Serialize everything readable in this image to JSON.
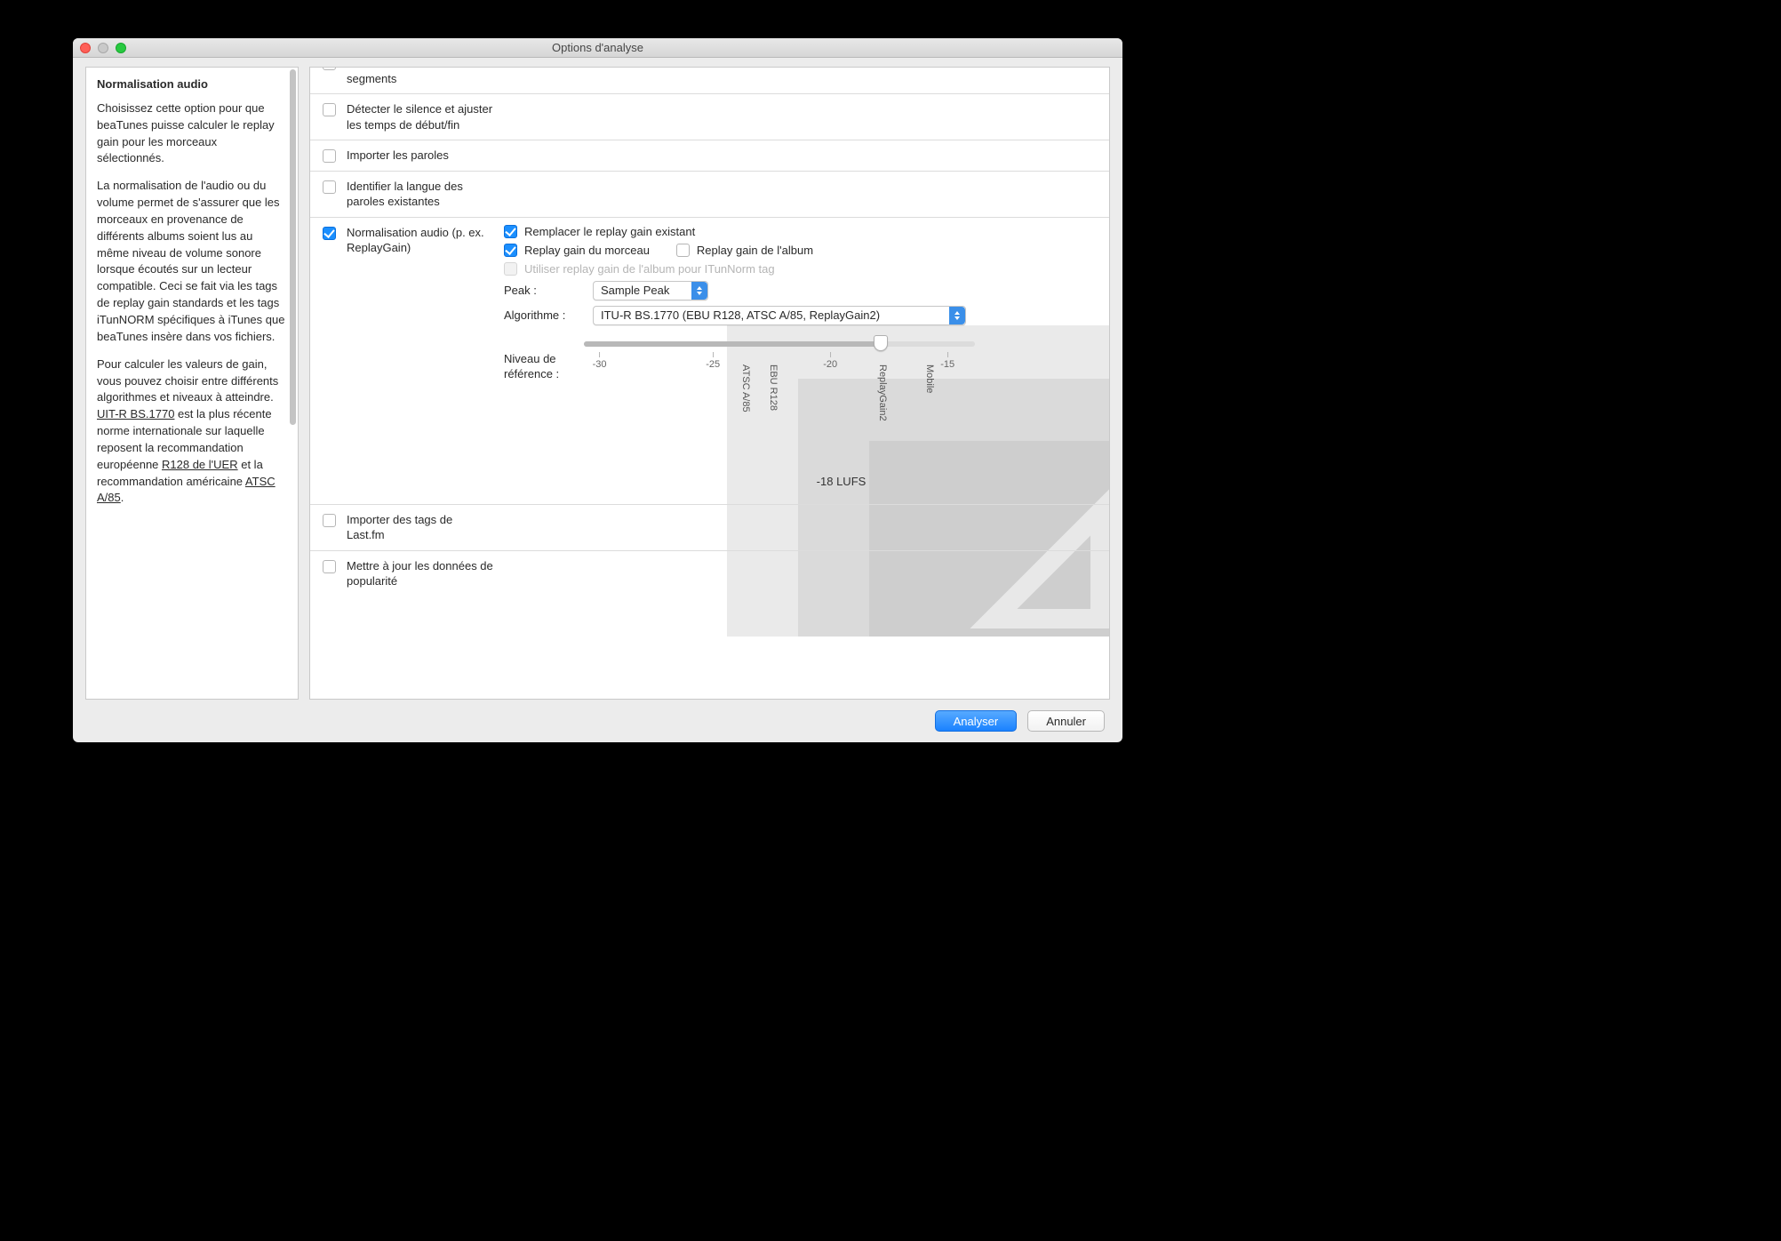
{
  "window": {
    "title": "Options d'analyse"
  },
  "sidebar": {
    "heading": "Normalisation audio",
    "p1": "Choisissez cette option pour que beaTunes puisse calculer le replay gain pour les morceaux sélectionnés.",
    "p2a": "La normalisation de l'audio ou du volume permet de s'assurer que les morceaux en provenance de différents albums soient lus au même niveau de volume sonore lorsque écoutés sur un lecteur compatible. Ceci se fait via les tags de replay gain standards et les tags iTunNORM spécifiques à iTunes que beaTunes insère dans vos fichiers.",
    "p3a": "Pour calculer les valeurs de gain, vous pouvez choisir entre différents algorithmes et niveaux à atteindre. ",
    "link1": "UIT-R BS.1770",
    "p3b": " est la plus récente norme internationale sur laquelle reposent la recommandation européenne ",
    "link2": "R128 de l'UER",
    "p3c": " et la recommandation américaine ",
    "link3": "ATSC A/85",
    "p3d": "."
  },
  "rows": {
    "similar": {
      "label": "Rechercher similarités et segments",
      "checked": false
    },
    "silence": {
      "label": "Détecter le silence et ajuster les temps de début/fin",
      "checked": false
    },
    "lyrics": {
      "label": "Importer les paroles",
      "checked": false
    },
    "lang": {
      "label": "Identifier la langue des paroles existantes",
      "checked": false
    },
    "norm": {
      "label": "Normalisation audio (p. ex. ReplayGain)",
      "checked": true
    },
    "lastfm": {
      "label": "Importer des tags de Last.fm",
      "checked": false
    },
    "popularity": {
      "label": "Mettre à jour les données de popularité",
      "checked": false
    }
  },
  "norm": {
    "replace": {
      "label": "Remplacer le replay gain existant",
      "checked": true
    },
    "track": {
      "label": "Replay gain du morceau",
      "checked": true
    },
    "album": {
      "label": "Replay gain de l'album",
      "checked": false
    },
    "itun": {
      "label": "Utiliser replay gain de l'album pour ITunNorm tag",
      "checked": false,
      "disabled": true
    },
    "peak_label": "Peak :",
    "peak_value": "Sample Peak",
    "algo_label": "Algorithme :",
    "algo_value": "ITU-R BS.1770 (EBU R128, ATSC A/85, ReplayGain2)",
    "ref_label": "Niveau de référence :",
    "ticks": {
      "t30": "-30",
      "t25": "-25",
      "t20": "-20",
      "t15": "-15"
    },
    "marks": {
      "atsc": "ATSC A/85",
      "ebu": "EBU R128",
      "rg2": "ReplayGain2",
      "mobile": "Mobile"
    },
    "lufs": "-18 LUFS"
  },
  "footer": {
    "analyze": "Analyser",
    "cancel": "Annuler"
  }
}
